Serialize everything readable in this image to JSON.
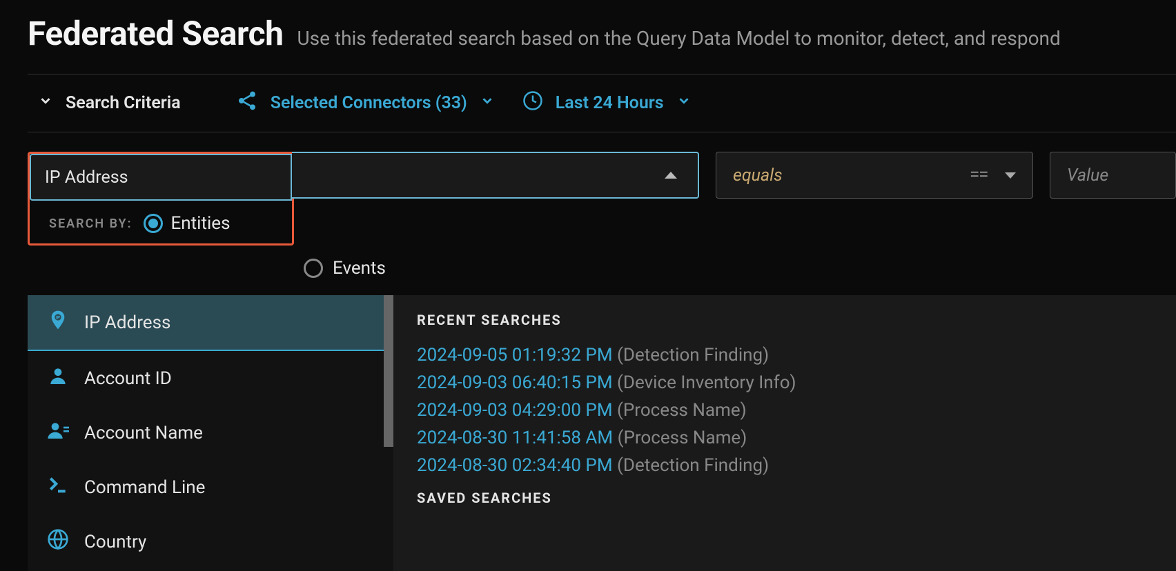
{
  "header": {
    "title": "Federated Search",
    "subtitle": "Use this federated search based on the Query Data Model to monitor, detect, and respond"
  },
  "criteria": {
    "label": "Search Criteria",
    "connectors": "Selected Connectors (33)",
    "timeRange": "Last 24 Hours"
  },
  "entityField": {
    "value": "IP Address"
  },
  "searchBy": {
    "label": "SEARCH BY:",
    "entities": "Entities",
    "events": "Events"
  },
  "operator": {
    "label": "equals",
    "symbol": "=="
  },
  "valueInput": {
    "placeholder": "Value"
  },
  "entityList": [
    {
      "label": "IP Address",
      "icon": "ip"
    },
    {
      "label": "Account ID",
      "icon": "user"
    },
    {
      "label": "Account Name",
      "icon": "userbadge"
    },
    {
      "label": "Command Line",
      "icon": "terminal"
    },
    {
      "label": "Country",
      "icon": "globe"
    }
  ],
  "recent": {
    "label": "RECENT SEARCHES",
    "items": [
      {
        "time": "2024-09-05 01:19:32 PM",
        "type": "(Detection Finding)"
      },
      {
        "time": "2024-09-03 06:40:15 PM",
        "type": "(Device Inventory Info)"
      },
      {
        "time": "2024-09-03 04:29:00 PM",
        "type": "(Process Name)"
      },
      {
        "time": "2024-08-30 11:41:58 AM",
        "type": "(Process Name)"
      },
      {
        "time": "2024-08-30 02:34:40 PM",
        "type": "(Detection Finding)"
      }
    ]
  },
  "saved": {
    "label": "SAVED SEARCHES"
  }
}
